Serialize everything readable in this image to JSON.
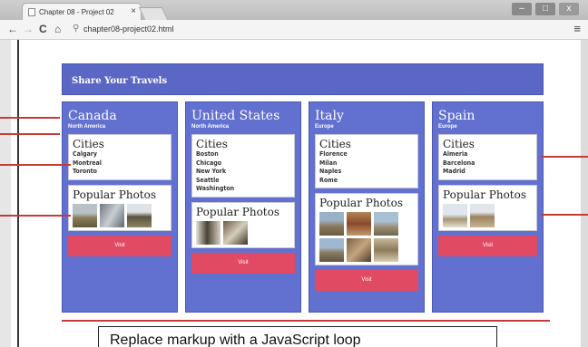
{
  "browser": {
    "tab_title": "Chapter 08 - Project 02",
    "tab_close": "×",
    "url": "chapter08-project02.html",
    "back": "←",
    "forward": "→",
    "reload": "C",
    "home": "⌂",
    "menu": "≡",
    "min": "‒",
    "max": "□",
    "close": "x"
  },
  "page": {
    "header": "Share Your Travels",
    "cities_heading": "Cities",
    "photos_heading": "Popular Photos",
    "visit_label": "Visit",
    "countries": [
      {
        "name": "Canada",
        "continent": "North America",
        "cities": [
          "Calgary",
          "Montreal",
          "Toronto"
        ],
        "photos": 3
      },
      {
        "name": "United States",
        "continent": "North America",
        "cities": [
          "Boston",
          "Chicago",
          "New York",
          "Seattle",
          "Washington"
        ],
        "photos": 2
      },
      {
        "name": "Italy",
        "continent": "Europe",
        "cities": [
          "Florence",
          "Milan",
          "Naples",
          "Rome"
        ],
        "photos": 6
      },
      {
        "name": "Spain",
        "continent": "Europe",
        "cities": [
          "Almeria",
          "Barcelona",
          "Madrid"
        ],
        "photos": 2
      }
    ]
  },
  "callout": "Replace markup with a JavaScript loop",
  "colors": {
    "card": "#6270cf",
    "visit": "#e14a63",
    "annotation": "#c73a38"
  }
}
